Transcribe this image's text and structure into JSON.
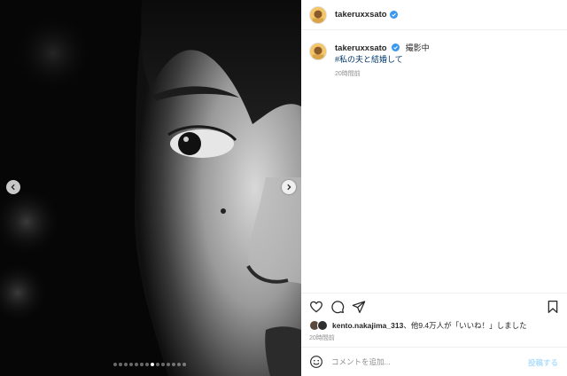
{
  "post": {
    "username": "takeruxxsato",
    "verified": true
  },
  "caption": {
    "username": "takeruxxsato",
    "text": "撮影中",
    "hashtag": "#私の夫と結婚して",
    "time": "20時間前"
  },
  "carousel": {
    "dot_count": 14,
    "active_index": 7
  },
  "likes": {
    "user": "kento.nakajima_313",
    "text": "、他9.4万人が「いいね！」しました"
  },
  "post_time": "20時間前",
  "comment": {
    "placeholder": "コメントを追加...",
    "post_label": "投稿する"
  },
  "colors": {
    "accent_link": "#00376b",
    "verified_blue": "#3897f0",
    "post_disabled": "#b2dffc",
    "muted_text": "#8e8e8e"
  },
  "icons": [
    "chevron-left-icon",
    "chevron-right-icon",
    "heart-icon",
    "comment-icon",
    "share-icon",
    "bookmark-icon",
    "emoji-icon",
    "verified-icon"
  ]
}
